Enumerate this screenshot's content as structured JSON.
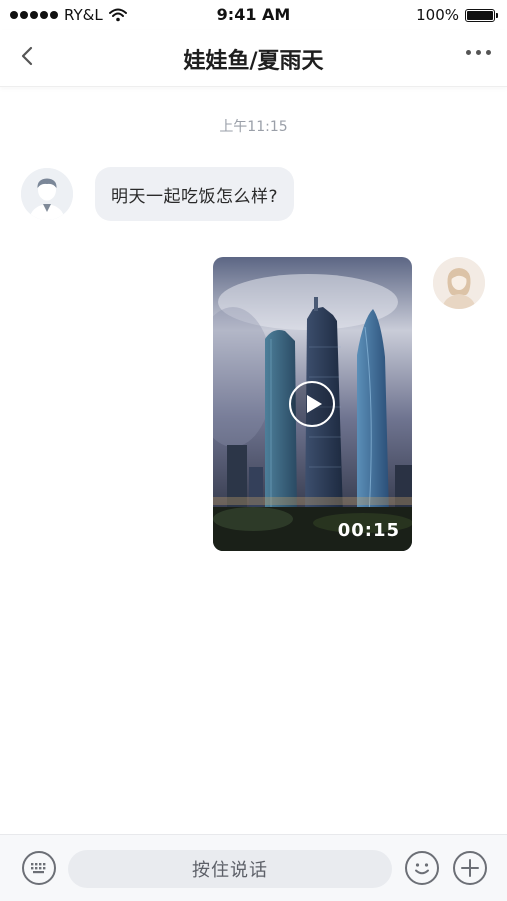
{
  "status_bar": {
    "carrier": "RY&L",
    "time": "9:41 AM",
    "battery": "100%"
  },
  "nav": {
    "title": "娃娃鱼/夏雨天"
  },
  "chat": {
    "timestamp": "上午11:15",
    "messages": [
      {
        "side": "left",
        "type": "text",
        "text": "明天一起吃饭怎么样?"
      },
      {
        "side": "right",
        "type": "video",
        "duration": "00:15"
      }
    ]
  },
  "input_bar": {
    "hold_to_talk_label": "按住说话"
  },
  "icons": {
    "back": "chevron-left-icon",
    "more": "more-horizontal-icon",
    "wifi": "wifi-icon",
    "battery": "battery-icon",
    "keyboard": "keyboard-icon",
    "emoji": "emoji-icon",
    "plus": "plus-icon",
    "play": "play-icon"
  },
  "colors": {
    "bubble_bg": "#eef0f4",
    "input_bg": "#e9ebef",
    "timestamp": "#9a9fa8"
  }
}
